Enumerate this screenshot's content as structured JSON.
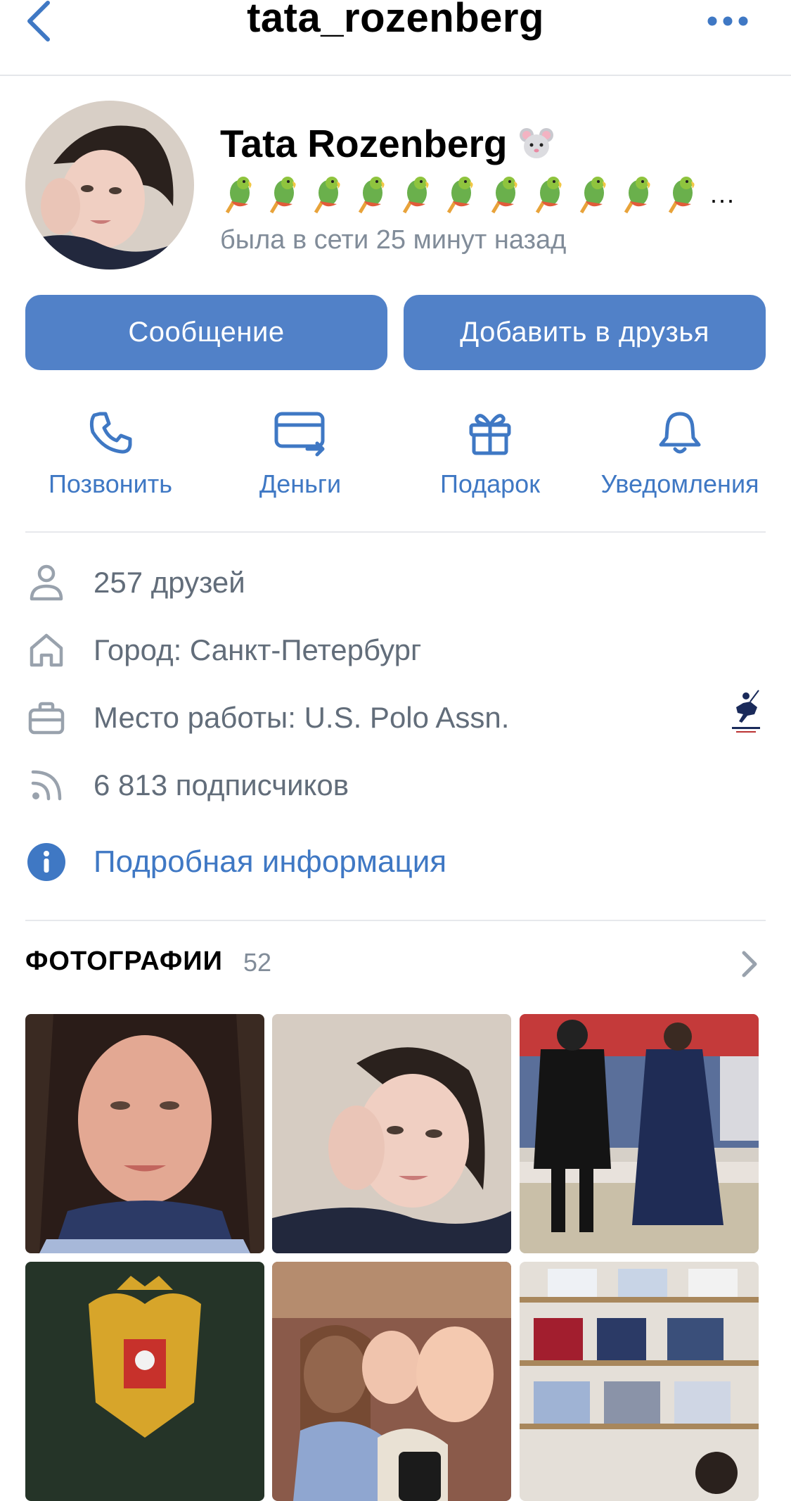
{
  "header": {
    "title": "tata_rozenberg"
  },
  "profile": {
    "name": "Tata Rozenberg",
    "online_status": "была в сети 25 минут назад",
    "status_emoji_count": 11
  },
  "buttons": {
    "message": "Сообщение",
    "add_friend": "Добавить в друзья"
  },
  "actions": [
    {
      "label": "Позвонить",
      "icon": "phone-icon"
    },
    {
      "label": "Деньги",
      "icon": "money-transfer-icon"
    },
    {
      "label": "Подарок",
      "icon": "gift-icon"
    },
    {
      "label": "Уведомления",
      "icon": "bell-icon"
    }
  ],
  "info": {
    "friends": "257 друзей",
    "city": "Город: Санкт-Петербург",
    "work": "Место работы: U.S. Polo Assn.",
    "followers": "6 813 подписчиков",
    "details_link": "Подробная информация"
  },
  "photos": {
    "title": "ФОТОГРАФИИ",
    "count": "52"
  },
  "colors": {
    "accent": "#5181c8",
    "link": "#3f78c4",
    "secondary_text": "#818c99",
    "info_text": "#626d7a"
  }
}
